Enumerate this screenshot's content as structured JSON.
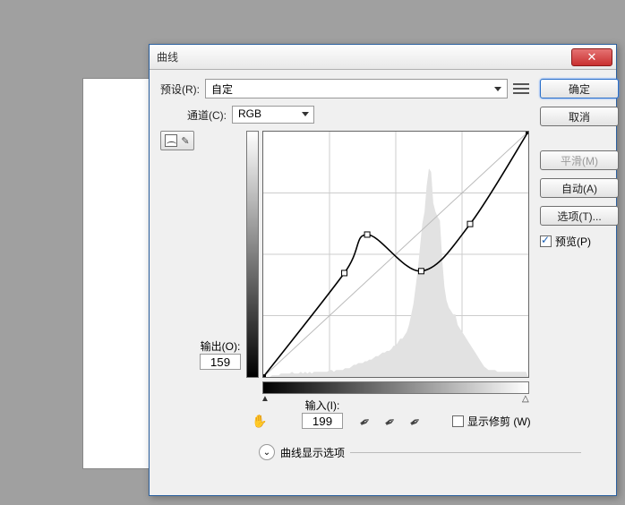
{
  "dialog": {
    "title": "曲线",
    "preset_label": "预设(R):",
    "preset_value": "自定",
    "channel_label": "通道(C):",
    "channel_value": "RGB",
    "output_label": "输出(O):",
    "output_value": "159",
    "input_label": "输入(I):",
    "input_value": "199",
    "show_clip_label": "显示修剪 (W)",
    "curve_options_label": "曲线显示选项",
    "expand_glyph": "⌄"
  },
  "buttons": {
    "ok": "确定",
    "cancel": "取消",
    "smooth": "平滑(M)",
    "auto": "自动(A)",
    "options": "选项(T)...",
    "preview": "预览(P)",
    "close_glyph": "✕"
  },
  "chart_data": {
    "type": "line",
    "title": "",
    "xlabel": "输入",
    "ylabel": "输出",
    "xlim": [
      0,
      255
    ],
    "ylim": [
      0,
      255
    ],
    "curve_points": [
      {
        "x": 0,
        "y": 0
      },
      {
        "x": 78,
        "y": 108
      },
      {
        "x": 100,
        "y": 148
      },
      {
        "x": 152,
        "y": 110
      },
      {
        "x": 199,
        "y": 159
      },
      {
        "x": 255,
        "y": 255
      }
    ],
    "baseline": [
      {
        "x": 0,
        "y": 0
      },
      {
        "x": 255,
        "y": 255
      }
    ],
    "histogram": [
      0,
      0,
      0,
      0,
      1,
      1,
      1,
      1,
      2,
      2,
      2,
      2,
      2,
      3,
      2,
      2,
      2,
      3,
      2,
      3,
      2,
      3,
      2,
      3,
      3,
      3,
      3,
      3,
      3,
      3,
      4,
      4,
      3,
      4,
      4,
      4,
      4,
      5,
      5,
      5,
      6,
      7,
      7,
      8,
      8,
      8,
      9,
      9,
      10,
      10,
      11,
      12,
      12,
      13,
      14,
      14,
      15,
      15,
      16,
      18,
      18,
      20,
      22,
      22,
      24,
      26,
      30,
      36,
      42,
      52,
      62,
      75,
      88,
      95,
      110,
      120,
      118,
      100,
      95,
      92,
      90,
      68,
      52,
      44,
      40,
      38,
      36,
      36,
      30,
      28,
      26,
      24,
      22,
      20,
      18,
      16,
      14,
      12,
      10,
      8,
      6,
      5,
      4,
      4,
      4,
      4,
      3,
      3,
      3,
      3,
      3,
      3,
      3,
      3,
      3,
      3,
      3,
      3,
      3,
      3
    ],
    "grid_divisions": 4
  }
}
